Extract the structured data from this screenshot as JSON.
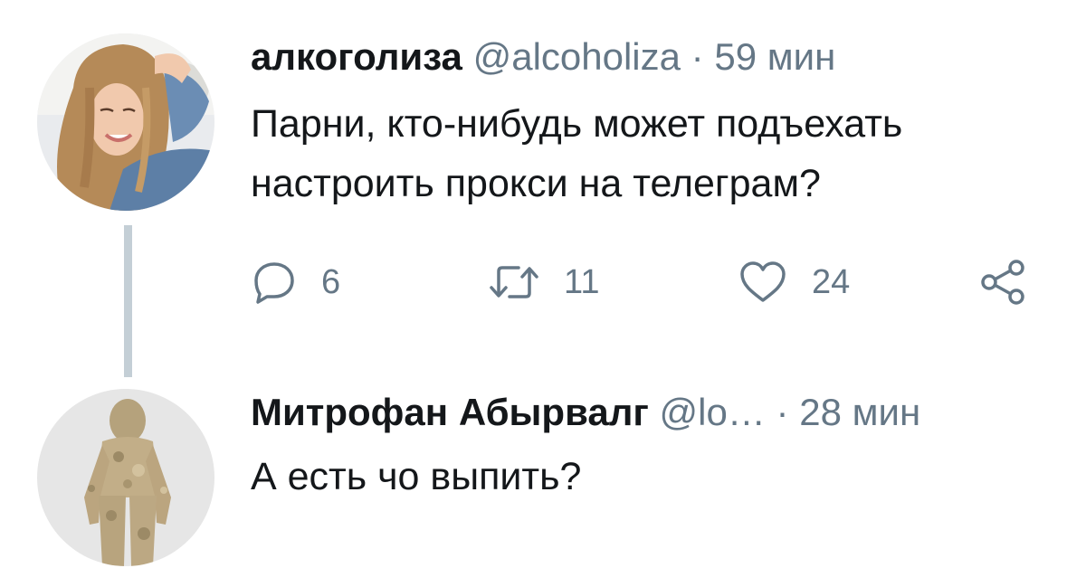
{
  "tweets": [
    {
      "display_name": "алкоголиза",
      "handle": "@alcoholiza",
      "separator": "·",
      "time": "59 мин",
      "text_lines": [
        "Парни, кто-нибудь может подъехать",
        "настроить прокси на телеграм?"
      ],
      "actions": {
        "replies": "6",
        "retweets": "11",
        "likes": "24"
      },
      "avatar_icon": "avatar-photo-woman"
    },
    {
      "display_name": "Митрофан Абырвалг",
      "handle": "@lo…",
      "separator": "·",
      "time": "28 мин",
      "text_lines": [
        "А есть чо выпить?"
      ],
      "avatar_icon": "avatar-photo-camouflage-suit"
    }
  ],
  "icons": {
    "reply": "reply-icon",
    "retweet": "retweet-icon",
    "like": "heart-icon",
    "share": "share-icon"
  },
  "colors": {
    "text": "#14171a",
    "secondary": "#657786",
    "thread_line": "#c4cfd6",
    "background": "#ffffff"
  }
}
